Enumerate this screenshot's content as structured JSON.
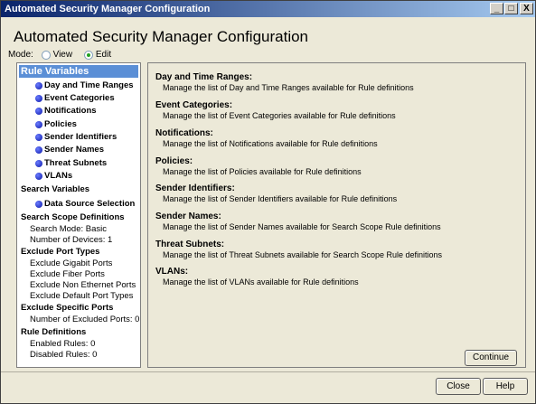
{
  "window": {
    "title": "Automated Security Manager Configuration",
    "min_glyph": "_",
    "max_glyph": "□",
    "close_glyph": "X"
  },
  "header": {
    "title": "Automated Security Manager Configuration"
  },
  "mode": {
    "label": "Mode:",
    "view_label": "View",
    "edit_label": "Edit",
    "selected": "Edit"
  },
  "tree": {
    "rule_variables": "Rule Variables",
    "rule_items": [
      "Day and Time Ranges",
      "Event Categories",
      "Notifications",
      "Policies",
      "Sender Identifiers",
      "Sender Names",
      "Threat Subnets",
      "VLANs"
    ],
    "search_variables": "Search Variables",
    "search_items": [
      "Data Source Selection"
    ],
    "scope_title": "Search Scope Definitions",
    "scope_lines": [
      "Search Mode: Basic",
      "Number of Devices: 1"
    ],
    "exclude_types_title": "Exclude Port Types",
    "exclude_types_lines": [
      "Exclude Gigabit Ports",
      "Exclude Fiber Ports",
      "Exclude Non Ethernet Ports",
      "Exclude Default Port Types"
    ],
    "exclude_specific_title": "Exclude Specific Ports",
    "exclude_specific_lines": [
      "Number of Excluded Ports: 0"
    ],
    "rule_defs_title": "Rule Definitions",
    "rule_defs_lines": [
      "Enabled  Rules: 0",
      "Disabled Rules: 0"
    ]
  },
  "details": [
    {
      "title": "Day and Time Ranges:",
      "desc": "Manage the list of Day and Time Ranges available for Rule definitions"
    },
    {
      "title": "Event Categories:",
      "desc": "Manage the list of Event Categories available for Rule definitions"
    },
    {
      "title": "Notifications:",
      "desc": "Manage the list of Notifications available for Rule definitions"
    },
    {
      "title": "Policies:",
      "desc": "Manage the list of Policies available for Rule definitions"
    },
    {
      "title": "Sender Identifiers:",
      "desc": "Manage the list of Sender Identifiers available for Rule definitions"
    },
    {
      "title": "Sender Names:",
      "desc": "Manage the list of Sender Names available for Search Scope Rule definitions"
    },
    {
      "title": "Threat Subnets:",
      "desc": "Manage the list of Threat Subnets available for Search Scope Rule definitions"
    },
    {
      "title": "VLANs:",
      "desc": "Manage the list of VLANs available for Rule definitions"
    }
  ],
  "buttons": {
    "continue": "Continue",
    "close": "Close",
    "help": "Help"
  }
}
